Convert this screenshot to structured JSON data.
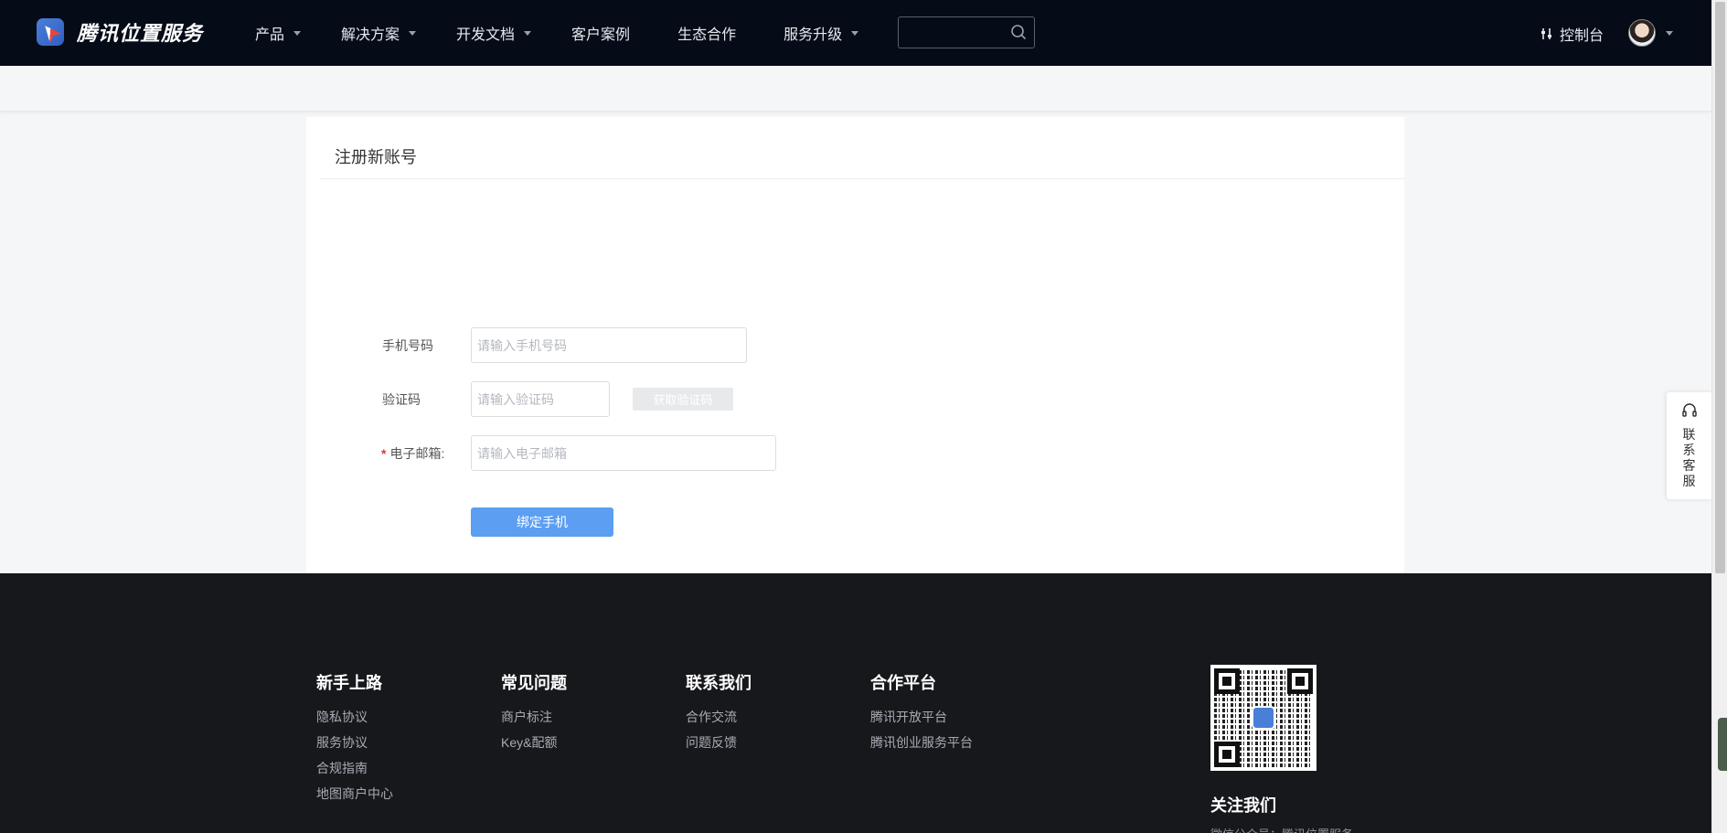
{
  "header": {
    "brand": "腾讯位置服务",
    "nav": [
      {
        "label": "产品",
        "has_dropdown": true
      },
      {
        "label": "解决方案",
        "has_dropdown": true
      },
      {
        "label": "开发文档",
        "has_dropdown": true
      },
      {
        "label": "客户案例",
        "has_dropdown": false
      },
      {
        "label": "生态合作",
        "has_dropdown": false
      },
      {
        "label": "服务升级",
        "has_dropdown": true
      }
    ],
    "search": {
      "value": "",
      "placeholder": ""
    },
    "console_label": "控制台"
  },
  "register": {
    "title": "注册新账号",
    "phone": {
      "label": "手机号码",
      "placeholder": "请输入手机号码",
      "value": ""
    },
    "code": {
      "label": "验证码",
      "placeholder": "请输入验证码",
      "value": "",
      "button": "获取验证码"
    },
    "email": {
      "label": "电子邮箱:",
      "required_mark": "*",
      "placeholder": "请输入电子邮箱",
      "value": ""
    },
    "submit": "绑定手机"
  },
  "footer": {
    "columns": [
      {
        "title": "新手上路",
        "links": [
          "隐私协议",
          "服务协议",
          "合规指南",
          "地图商户中心"
        ]
      },
      {
        "title": "常见问题",
        "links": [
          "商户标注",
          "Key&配额"
        ]
      },
      {
        "title": "联系我们",
        "links": [
          "合作交流",
          "问题反馈"
        ]
      },
      {
        "title": "合作平台",
        "links": [
          "腾讯开放平台",
          "腾讯创业服务平台"
        ]
      }
    ],
    "follow_title": "关注我们",
    "follow_sub": "微信公众号：腾讯位置服务"
  },
  "service_tab": {
    "label": "联系客服"
  },
  "colors": {
    "nav_bg": "#050b17",
    "primary_button": "#5b9ef2",
    "footer_bg": "#17181c",
    "required": "#e0393e"
  }
}
